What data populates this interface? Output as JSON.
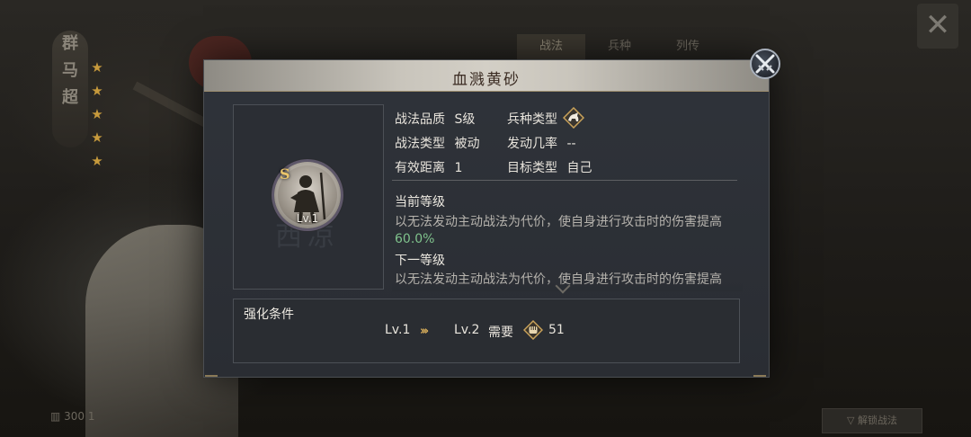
{
  "background": {
    "hero_name_chars": [
      "群",
      "马",
      "超"
    ],
    "star_count": 5,
    "tabs": [
      "战法",
      "兵种",
      "列传"
    ],
    "bottom_left_text": "▥ 300 1",
    "bottom_right_text": "▽ 解锁战法"
  },
  "dialog": {
    "title": "血溅黄砂",
    "portrait": {
      "grade_badge": "S",
      "level": "Lv.1",
      "emblem": "西凉"
    },
    "attributes": {
      "quality_label": "战法品质",
      "quality_value": "S级",
      "troop_label": "兵种类型",
      "troop_icon": "cavalry-icon",
      "type_label": "战法类型",
      "type_value": "被动",
      "rate_label": "发动几率",
      "rate_value": "--",
      "range_label": "有效距离",
      "range_value": "1",
      "target_label": "目标类型",
      "target_value": "自己"
    },
    "current_level": {
      "title": "当前等级",
      "description": "以无法发动主动战法为代价，使自身进行攻击时的伤害提高",
      "value": "60.0%"
    },
    "next_level": {
      "title": "下一等级",
      "description": "以无法发动主动战法为代价，使自身进行攻击时的伤害提高"
    },
    "upgrade": {
      "title": "强化条件",
      "from_level": "Lv.1",
      "arrow": "›››",
      "to_level": "Lv.2",
      "need_label": "需要",
      "cost": "51",
      "cost_icon": "fist-token-icon"
    }
  },
  "colors": {
    "highlight_value": "#7fc28c",
    "gold_accent": "#d7ad5a",
    "header_title": "#3a2b22"
  }
}
